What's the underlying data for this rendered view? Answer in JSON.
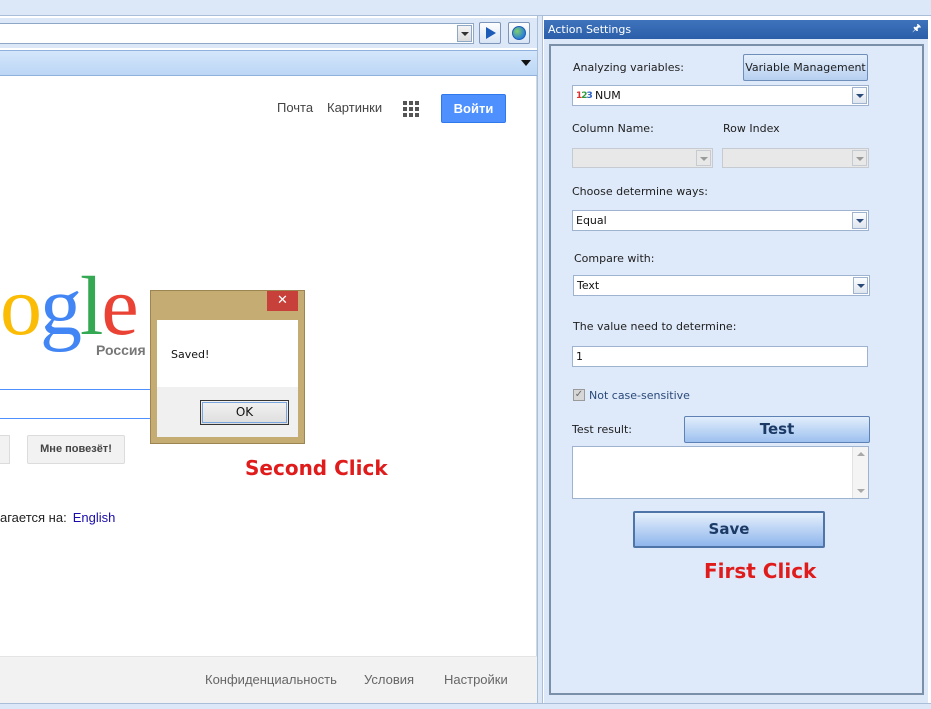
{
  "browser": {
    "nav": {
      "go_icon": "play-icon",
      "globe_icon": "globe-icon"
    },
    "header_links": {
      "mail": "Почта",
      "images": "Картинки",
      "apps_icon": "apps-grid-icon",
      "signin": "Войти"
    },
    "logo": {
      "part1": "o",
      "part2": "g",
      "part3": "l",
      "part4": "e",
      "region": "Россия"
    },
    "lucky_button": "Мне повезёт!",
    "offered_prefix": "агается на:",
    "offered_language": "English",
    "footer": {
      "privacy": "Конфиденциальность",
      "terms": "Условия",
      "settings": "Настройки"
    }
  },
  "dialog": {
    "close": "✕",
    "message": "Saved!",
    "ok": "OK"
  },
  "annotations": {
    "second_click": "Second Click",
    "first_click": "First Click"
  },
  "panel": {
    "title": "Action Settings",
    "pin_icon": "pin-icon",
    "analyzing_label": "Analyzing variables:",
    "variable_management": "Variable Management",
    "variable_value": "NUM",
    "column_name_label": "Column Name:",
    "row_index_label": "Row Index",
    "determine_ways_label": "Choose determine ways:",
    "determine_ways_value": "Equal",
    "compare_with_label": "Compare with:",
    "compare_with_value": "Text",
    "value_label": "The value need to determine:",
    "value": "1",
    "case_label": "Not case-sensitive",
    "case_checked": true,
    "test_result_label": "Test result:",
    "test_button": "Test",
    "save_button": "Save"
  },
  "colors": {
    "panel_header": "#2a5ea8",
    "annotation": "#e01b1b",
    "signin": "#4d90fe"
  }
}
